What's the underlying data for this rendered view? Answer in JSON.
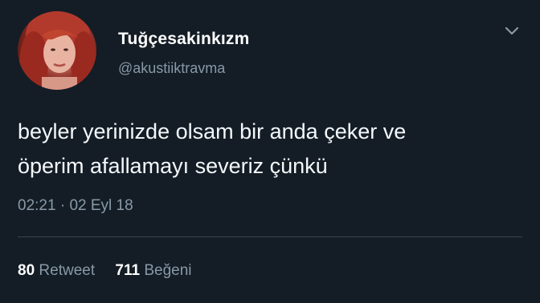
{
  "tweet": {
    "display_name": "Tuğçesakinkızm",
    "handle": "@akustiiktravma",
    "text": "beyler yerinizde olsam bir anda çeker ve\nöperim afallamayı severiz çünkü",
    "time": "02:21",
    "separator": "·",
    "date": "02 Eyl 18",
    "retweet_count": "80",
    "retweet_label": "Retweet",
    "like_count": "711",
    "like_label": "Beğeni"
  },
  "icons": {
    "menu": "chevron-down-icon"
  },
  "colors": {
    "background": "#141d26",
    "secondary_text": "#8899a6",
    "divider": "#38444d"
  }
}
